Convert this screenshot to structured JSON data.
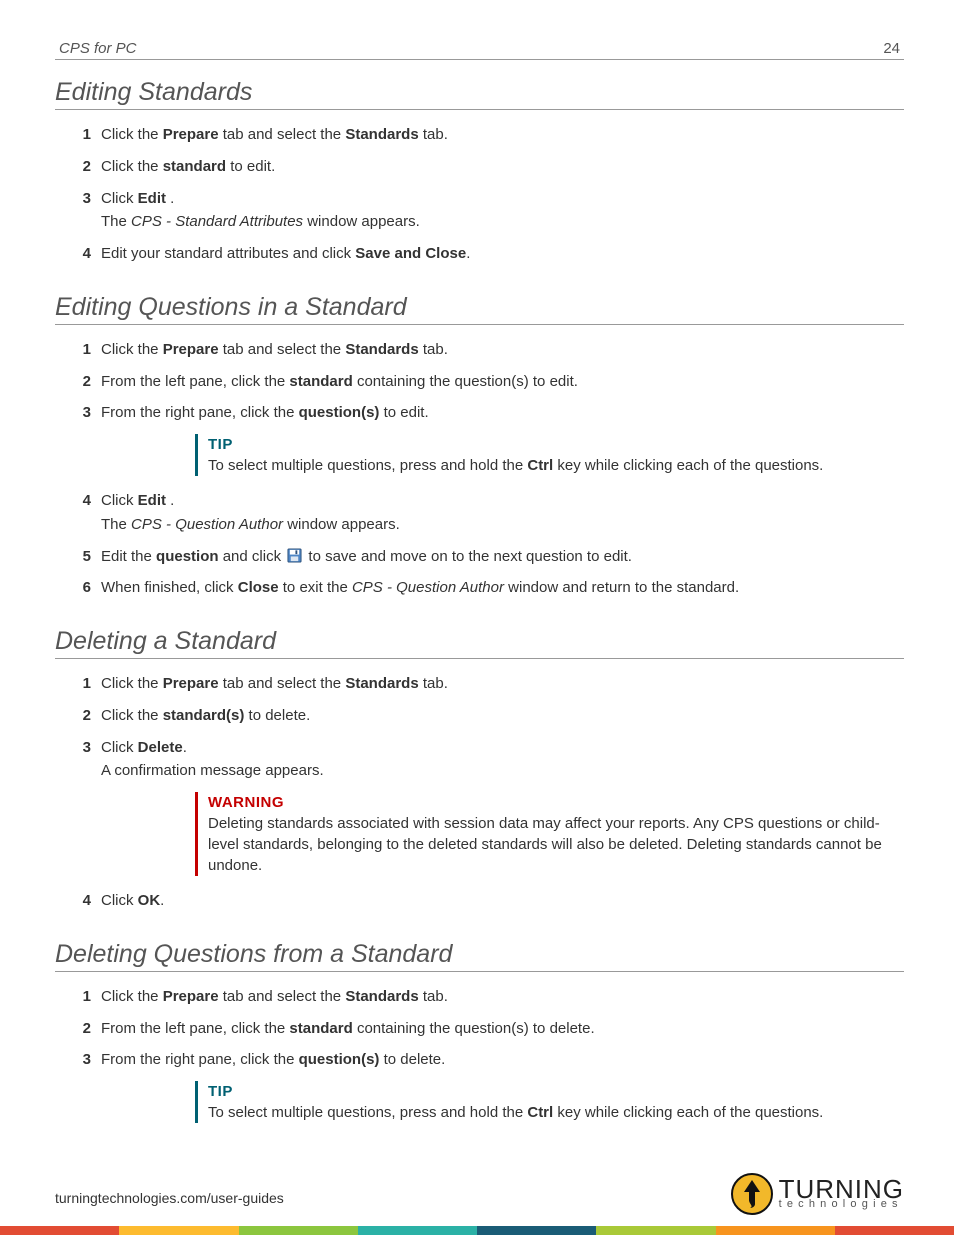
{
  "header": {
    "doc_title": "CPS for PC",
    "page_number": "24"
  },
  "sec1": {
    "title": "Editing Standards",
    "s1a": "Click the ",
    "s1b": "Prepare",
    "s1c": " tab and select the ",
    "s1d": "Standards",
    "s1e": " tab.",
    "s2a": "Click the ",
    "s2b": "standard",
    "s2c": " to edit.",
    "s3a": "Click ",
    "s3b": "Edit",
    "s3c": " .",
    "s3sub_a": "The ",
    "s3sub_b": "CPS - Standard Attributes",
    "s3sub_c": " window appears.",
    "s4a": "Edit your standard attributes and click ",
    "s4b": "Save and Close",
    "s4c": "."
  },
  "sec2": {
    "title": "Editing Questions in a Standard",
    "s1a": "Click the ",
    "s1b": "Prepare",
    "s1c": " tab and select the ",
    "s1d": "Standards",
    "s1e": " tab.",
    "s2a": "From the left pane, click the ",
    "s2b": "standard",
    "s2c": " containing the question(s) to edit.",
    "s3a": "From the right pane, click the ",
    "s3b": "question(s)",
    "s3c": " to edit.",
    "tip1_label": "TIP",
    "tip1a": "To select multiple questions, press and hold the ",
    "tip1b": "Ctrl",
    "tip1c": " key while clicking each of the questions.",
    "s4a": "Click ",
    "s4b": "Edit",
    "s4c": " .",
    "s4sub_a": "The ",
    "s4sub_b": "CPS - Question Author",
    "s4sub_c": " window appears.",
    "s5a": "Edit the ",
    "s5b": "question",
    "s5c": " and click ",
    "s5d": " to save and move on to the next question to edit.",
    "s6a": "When finished, click ",
    "s6b": "Close",
    "s6c": " to exit the ",
    "s6d": "CPS - Question Author",
    "s6e": " window and return to the standard."
  },
  "sec3": {
    "title": "Deleting a Standard",
    "s1a": "Click the ",
    "s1b": "Prepare",
    "s1c": " tab and select the ",
    "s1d": "Standards",
    "s1e": " tab.",
    "s2a": "Click the ",
    "s2b": "standard(s)",
    "s2c": " to delete.",
    "s3a": "Click ",
    "s3b": "Delete",
    "s3c": ".",
    "s3sub": "A confirmation message appears.",
    "warn_label": "WARNING",
    "warn_body": "Deleting standards associated with session data may affect your reports. Any CPS questions or child-level standards, belonging to the deleted standards will also be deleted. Deleting standards cannot be undone.",
    "s4a": "Click ",
    "s4b": "OK",
    "s4c": "."
  },
  "sec4": {
    "title": "Deleting Questions from a Standard",
    "s1a": "Click the ",
    "s1b": "Prepare",
    "s1c": " tab and select the ",
    "s1d": "Standards",
    "s1e": " tab.",
    "s2a": "From the left pane, click the ",
    "s2b": "standard",
    "s2c": " containing the question(s) to delete.",
    "s3a": "From the right pane, click the ",
    "s3b": "question(s)",
    "s3c": " to delete.",
    "tip2_label": "TIP",
    "tip2a": "To select multiple questions, press and hold the ",
    "tip2b": "Ctrl",
    "tip2c": " key while clicking each of the questions."
  },
  "footer": {
    "url": "turningtechnologies.com/user-guides",
    "logo_top": "TURNING",
    "logo_bot": "technologies"
  }
}
